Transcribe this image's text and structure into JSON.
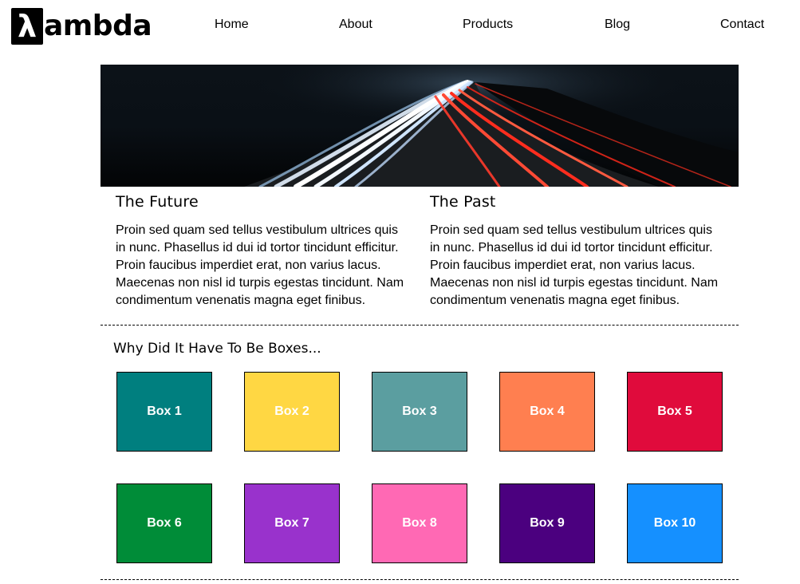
{
  "header": {
    "logo_symbol": "λ",
    "logo_text": "ambda",
    "nav": [
      "Home",
      "About",
      "Products",
      "Blog",
      "Contact"
    ]
  },
  "hero": {
    "image": "night-highway-light-trails"
  },
  "columns": [
    {
      "title": "The Future",
      "text": "Proin sed quam sed tellus vestibulum ultrices quis in nunc. Phasellus id dui id tortor tincidunt efficitur. Proin faucibus imperdiet erat, non varius lacus. Maecenas non nisl id turpis egestas tincidunt. Nam condimentum venenatis magna eget finibus."
    },
    {
      "title": "The Past",
      "text": "Proin sed quam sed tellus vestibulum ultrices quis in nunc. Phasellus id dui id tortor tincidunt efficitur. Proin faucibus imperdiet erat, non varius lacus. Maecenas non nisl id turpis egestas tincidunt. Nam condimentum venenatis magna eget finibus."
    }
  ],
  "boxes_section": {
    "title": "Why Did It Have To Be Boxes...",
    "boxes": [
      {
        "label": "Box 1",
        "color": "#007f7f"
      },
      {
        "label": "Box 2",
        "color": "#ffd743"
      },
      {
        "label": "Box 3",
        "color": "#5b9ea0"
      },
      {
        "label": "Box 4",
        "color": "#ff7f50"
      },
      {
        "label": "Box 5",
        "color": "#e00b3c"
      },
      {
        "label": "Box 6",
        "color": "#008c38"
      },
      {
        "label": "Box 7",
        "color": "#9932cc"
      },
      {
        "label": "Box 8",
        "color": "#ff69b4"
      },
      {
        "label": "Box 9",
        "color": "#4b007f"
      },
      {
        "label": "Box 10",
        "color": "#1590ff"
      }
    ]
  }
}
